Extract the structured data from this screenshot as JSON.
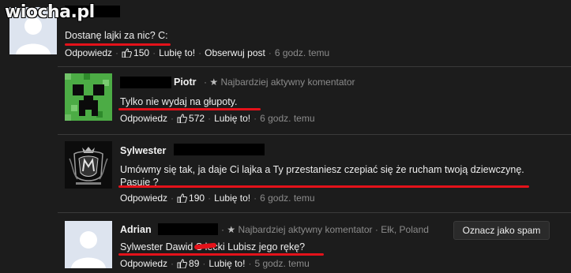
{
  "watermark": "wiocha.pl",
  "comments": [
    {
      "name": "",
      "badge": "",
      "location": "",
      "text_lines": [
        "Dostanę lajki za nic? C:"
      ],
      "actions": {
        "reply": "Odpowiedz",
        "likes": "150",
        "like": "Lubię to!",
        "follow": "Obserwuj post",
        "time": "6 godz. temu"
      },
      "avatar": "default-silhouette"
    },
    {
      "name": "Piotr",
      "badge": "Najbardziej aktywny komentator",
      "location": "",
      "text_lines": [
        "Tylko nie wydaj na głupoty."
      ],
      "actions": {
        "reply": "Odpowiedz",
        "likes": "572",
        "like": "Lubię to!",
        "time": "6 godz. temu"
      },
      "avatar": "creeper"
    },
    {
      "name": "Sylwester",
      "badge": "",
      "location": "",
      "text_lines": [
        "Umówmy się tak, ja daje Ci lajka a Ty przestaniesz czepiać się że rucham twoją dziewczynę.",
        "Pasuje ?"
      ],
      "actions": {
        "reply": "Odpowiedz",
        "likes": "190",
        "like": "Lubię to!",
        "time": "6 godz. temu"
      },
      "avatar": "emblem"
    },
    {
      "name": "Adrian",
      "badge": "Najbardziej aktywny komentator",
      "location": "Ełk, Poland",
      "text_lines": [
        "Sylwester Dawid S  lecki Lubisz jego rękę?"
      ],
      "actions": {
        "reply": "Odpowiedz",
        "likes": "89",
        "like": "Lubię to!",
        "time": "5 godz. temu"
      },
      "avatar": "default-silhouette"
    }
  ],
  "spam_button": "Oznacz jako spam",
  "colors": {
    "background": "#1c1c1c",
    "underline": "#e4121a",
    "creeper": "#3fa33c"
  }
}
